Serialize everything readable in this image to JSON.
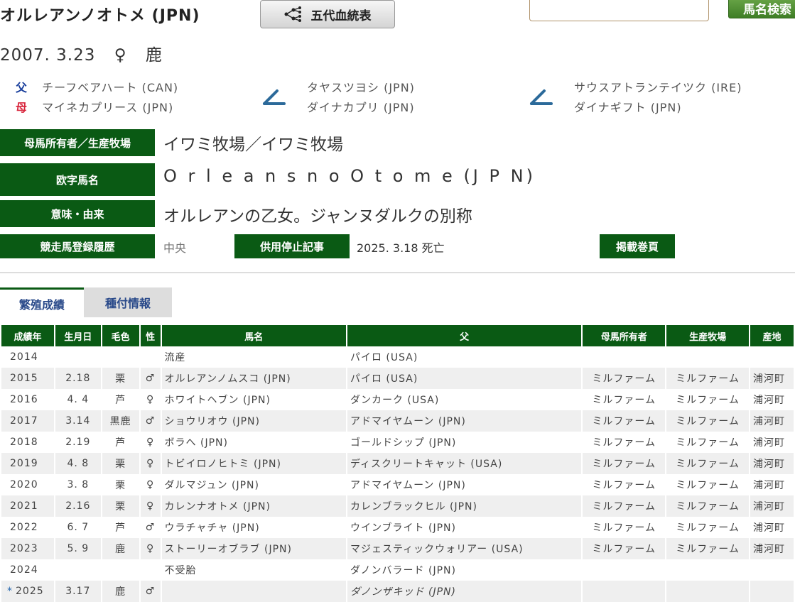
{
  "header": {
    "horse_name": "オルレアンノオトメ (JPN)",
    "pedigree_button": "五代血統表",
    "search_placeholder": "",
    "search_button": "馬名検索"
  },
  "birth": {
    "date": "2007. 3.23",
    "sex": "♀",
    "color": "鹿"
  },
  "parents": {
    "sire_tag": "父",
    "dam_tag": "母",
    "sire": "チーフベアハート (CAN)",
    "dam": "マイネカプリース (JPN)",
    "sire_sire": "タヤスツヨシ (JPN)",
    "sire_dam": "ダイナカプリ (JPN)",
    "dam_sire": "サウスアトランテイツク (IRE)",
    "dam_dam": "ダイナギフト (JPN)"
  },
  "info": {
    "owner_label": "母馬所有者／生産牧場",
    "owner_value": "イワミ牧場／イワミ牧場",
    "roman_label": "欧字馬名",
    "roman_value": "O r l e a n s  n o  O t o m e (J P N)",
    "meaning_label": "意味・由来",
    "meaning_value": "オルレアンの乙女。ジャンヌダルクの別称",
    "registry_label": "競走馬登録履歴",
    "registry_value": "中央",
    "retire_button": "供用停止記事",
    "retire_value": "2025. 3.18 死亡",
    "page_button": "掲載巻頁"
  },
  "tabs": {
    "breeding": "繁殖成績",
    "covering": "種付情報"
  },
  "table": {
    "headers": [
      "成績年",
      "生月日",
      "毛色",
      "性",
      "馬名",
      "父",
      "母馬所有者",
      "生産牧場",
      "産地"
    ],
    "rows": [
      {
        "mark": "",
        "year": "2014",
        "date": "",
        "color": "",
        "sex": "",
        "name": "流産",
        "sire": "パイロ (USA)",
        "owner": "",
        "farm": "",
        "place": ""
      },
      {
        "mark": "",
        "year": "2015",
        "date": "2.18",
        "color": "栗",
        "sex": "♂",
        "name": "オルレアンノムスコ (JPN)",
        "sire": "パイロ (USA)",
        "owner": "ミルファーム",
        "farm": "ミルファーム",
        "place": "浦河町"
      },
      {
        "mark": "",
        "year": "2016",
        "date": "4. 4",
        "color": "芦",
        "sex": "♀",
        "name": "ホワイトヘブン (JPN)",
        "sire": "ダンカーク (USA)",
        "owner": "ミルファーム",
        "farm": "ミルファーム",
        "place": "浦河町"
      },
      {
        "mark": "",
        "year": "2017",
        "date": "3.14",
        "color": "黒鹿",
        "sex": "♂",
        "name": "ショウリオウ (JPN)",
        "sire": "アドマイヤムーン (JPN)",
        "owner": "ミルファーム",
        "farm": "ミルファーム",
        "place": "浦河町"
      },
      {
        "mark": "",
        "year": "2018",
        "date": "2.19",
        "color": "芦",
        "sex": "♀",
        "name": "ボラへ (JPN)",
        "sire": "ゴールドシップ (JPN)",
        "owner": "ミルファーム",
        "farm": "ミルファーム",
        "place": "浦河町"
      },
      {
        "mark": "",
        "year": "2019",
        "date": "4. 8",
        "color": "栗",
        "sex": "♀",
        "name": "トビイロノヒトミ (JPN)",
        "sire": "ディスクリートキャット (USA)",
        "owner": "ミルファーム",
        "farm": "ミルファーム",
        "place": "浦河町"
      },
      {
        "mark": "",
        "year": "2020",
        "date": "3. 8",
        "color": "栗",
        "sex": "♀",
        "name": "ダルマジュン (JPN)",
        "sire": "アドマイヤムーン (JPN)",
        "owner": "ミルファーム",
        "farm": "ミルファーム",
        "place": "浦河町"
      },
      {
        "mark": "",
        "year": "2021",
        "date": "2.16",
        "color": "栗",
        "sex": "♀",
        "name": "カレンナオトメ (JPN)",
        "sire": "カレンブラックヒル (JPN)",
        "owner": "ミルファーム",
        "farm": "ミルファーム",
        "place": "浦河町"
      },
      {
        "mark": "",
        "year": "2022",
        "date": "6. 7",
        "color": "芦",
        "sex": "♂",
        "name": "ウラチャチャ (JPN)",
        "sire": "ウインブライト (JPN)",
        "owner": "ミルファーム",
        "farm": "ミルファーム",
        "place": "浦河町"
      },
      {
        "mark": "",
        "year": "2023",
        "date": "5. 9",
        "color": "鹿",
        "sex": "♀",
        "name": "ストーリーオブラブ (JPN)",
        "sire": "マジェスティックウォリアー (USA)",
        "owner": "ミルファーム",
        "farm": "ミルファーム",
        "place": "浦河町"
      },
      {
        "mark": "",
        "year": "2024",
        "date": "",
        "color": "",
        "sex": "",
        "name": "不受胎",
        "sire": "ダノンバラード (JPN)",
        "owner": "",
        "farm": "",
        "place": ""
      },
      {
        "mark": "*",
        "year": "2025",
        "date": "3.17",
        "color": "鹿",
        "sex": "♂",
        "name": "",
        "sire": "ダノンザキッド (JPN)",
        "owner": "",
        "farm": "",
        "place": ""
      }
    ]
  },
  "colors": {
    "accent_green": "#0a5a14",
    "sire_blue": "#1a3f9c",
    "dam_red": "#d8263d",
    "link_blue": "#2a6ab0"
  }
}
